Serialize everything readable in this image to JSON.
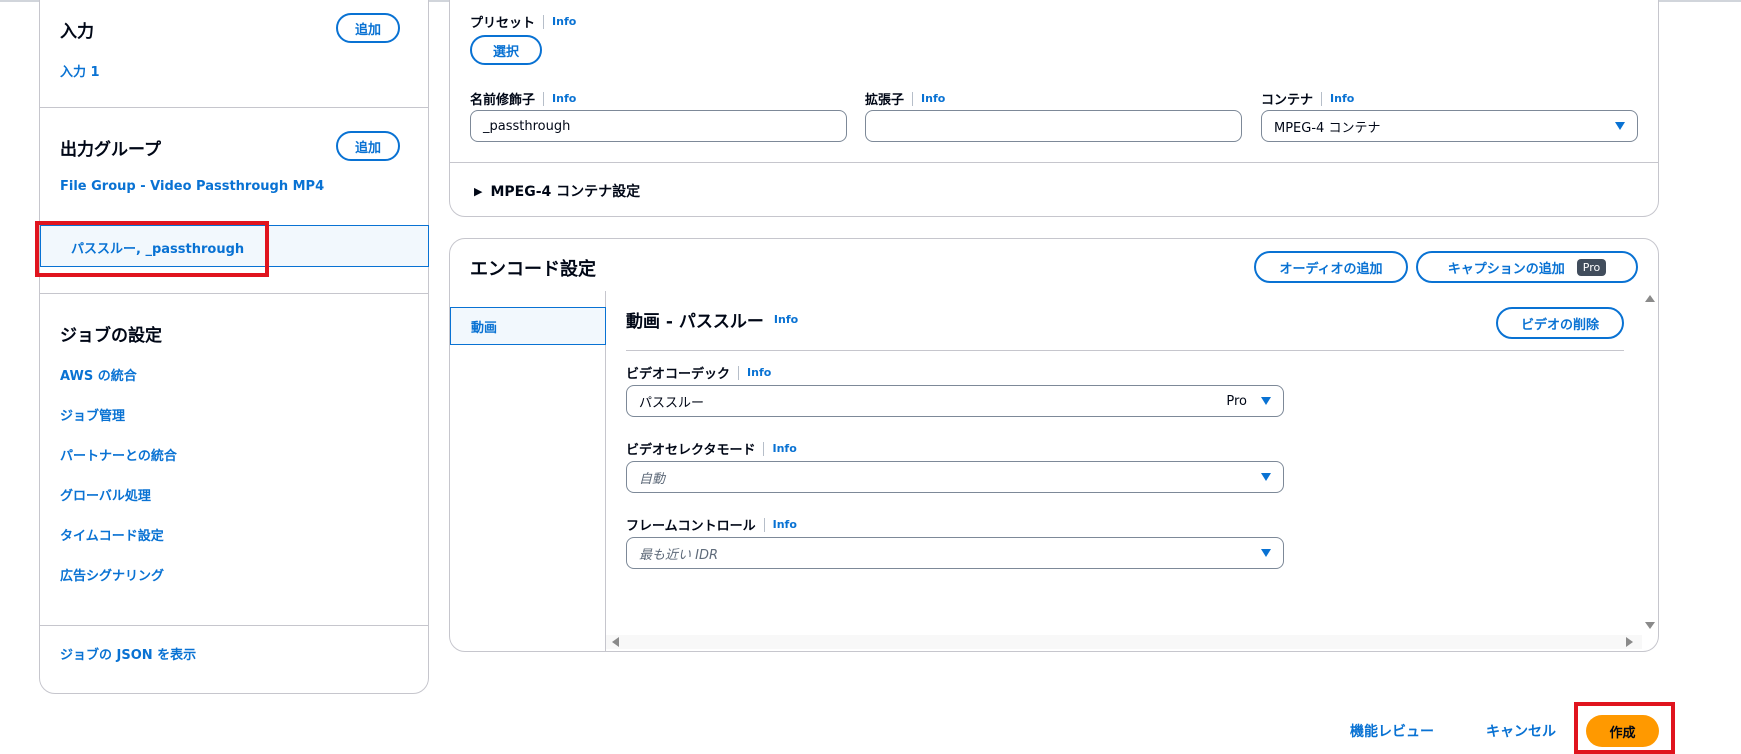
{
  "left_panel": {
    "inputs": {
      "title": "入力",
      "add_label": "追加",
      "items": [
        "入力 1"
      ]
    },
    "output_groups": {
      "title": "出力グループ",
      "add_label": "追加",
      "group_name": "File Group - Video Passthrough MP4",
      "selected_output": "パススルー, _passthrough"
    },
    "job_settings": {
      "title": "ジョブの設定",
      "items": [
        "AWS の統合",
        "ジョブ管理",
        "パートナーとの統合",
        "グローバル処理",
        "タイムコード設定",
        "広告シグナリング"
      ]
    },
    "view_json": "ジョブの JSON を表示"
  },
  "output_settings": {
    "preset_label": "プリセット",
    "preset_button": "選択",
    "name_modifier_label": "名前修飾子",
    "name_modifier_value": "_passthrough",
    "extension_label": "拡張子",
    "extension_value": "",
    "container_label": "コンテナ",
    "container_value": "MPEG-4 コンテナ",
    "mpeg4_settings": "MPEG-4 コンテナ設定",
    "info": "Info"
  },
  "encode": {
    "title": "エンコード設定",
    "add_audio": "オーディオの追加",
    "add_caption": "キャプションの追加",
    "pro_badge": "Pro",
    "tab_video": "動画",
    "section_title": "動画 - パススルー",
    "delete_video": "ビデオの削除",
    "codec_label": "ビデオコーデック",
    "codec_value": "パススルー",
    "codec_badge": "Pro",
    "selector_mode_label": "ビデオセレクタモード",
    "selector_mode_value": "自動",
    "frame_control_label": "フレームコントロール",
    "frame_control_value": "最も近い IDR"
  },
  "footer": {
    "feature_review": "機能レビュー",
    "cancel": "キャンセル",
    "create": "作成"
  },
  "colors": {
    "accent": "#0972d3",
    "primary_button": "#ff9900",
    "highlight": "#e0141e"
  }
}
